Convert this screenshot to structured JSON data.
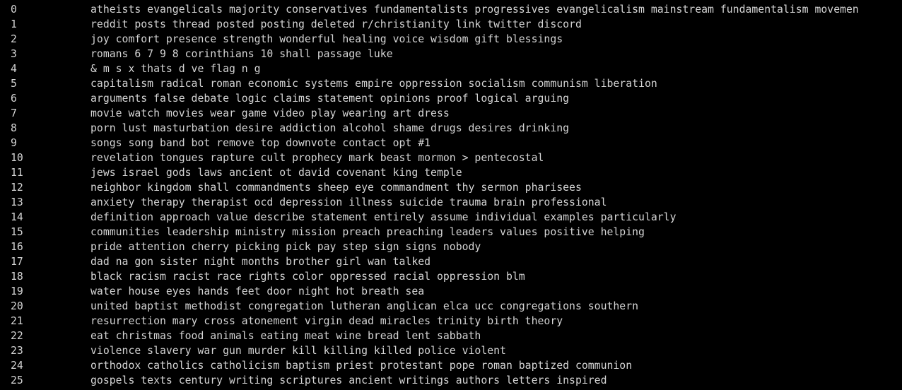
{
  "output": {
    "rows": [
      {
        "index": "0",
        "words": "atheists evangelicals majority conservatives fundamentalists progressives evangelicalism mainstream fundamentalism movemen"
      },
      {
        "index": "1",
        "words": "reddit posts thread posted posting deleted r/christianity link twitter discord"
      },
      {
        "index": "2",
        "words": "joy comfort presence strength wonderful healing voice wisdom gift blessings"
      },
      {
        "index": "3",
        "words": "romans 6 7 9 8 corinthians 10 shall passage luke"
      },
      {
        "index": "4",
        "words": "& m s x thats d ve flag n g"
      },
      {
        "index": "5",
        "words": "capitalism radical roman economic systems empire oppression socialism communism liberation"
      },
      {
        "index": "6",
        "words": "arguments false debate logic claims statement opinions proof logical arguing"
      },
      {
        "index": "7",
        "words": "movie watch movies wear game video play wearing art dress"
      },
      {
        "index": "8",
        "words": "porn lust masturbation desire addiction alcohol shame drugs desires drinking"
      },
      {
        "index": "9",
        "words": "songs song band bot remove top downvote contact opt #1"
      },
      {
        "index": "10",
        "words": "revelation tongues rapture cult prophecy mark beast mormon > pentecostal"
      },
      {
        "index": "11",
        "words": "jews israel gods laws ancient ot david covenant king temple"
      },
      {
        "index": "12",
        "words": "neighbor kingdom shall commandments sheep eye commandment thy sermon pharisees"
      },
      {
        "index": "13",
        "words": "anxiety therapy therapist ocd depression illness suicide trauma brain professional"
      },
      {
        "index": "14",
        "words": "definition approach value describe statement entirely assume individual examples particularly"
      },
      {
        "index": "15",
        "words": "communities leadership ministry mission preach preaching leaders values positive helping"
      },
      {
        "index": "16",
        "words": "pride attention cherry picking pick pay step sign signs nobody"
      },
      {
        "index": "17",
        "words": "dad na gon sister night months brother girl wan talked"
      },
      {
        "index": "18",
        "words": "black racism racist race rights color oppressed racial oppression blm"
      },
      {
        "index": "19",
        "words": "water house eyes hands feet door night hot breath sea"
      },
      {
        "index": "20",
        "words": "united baptist methodist congregation lutheran anglican elca ucc congregations southern"
      },
      {
        "index": "21",
        "words": "resurrection mary cross atonement virgin dead miracles trinity birth theory"
      },
      {
        "index": "22",
        "words": "eat christmas food animals eating meat wine bread lent sabbath"
      },
      {
        "index": "23",
        "words": "violence slavery war gun murder kill killing killed police violent"
      },
      {
        "index": "24",
        "words": "orthodox catholics catholicism baptism priest protestant pope roman baptized communion"
      },
      {
        "index": "25",
        "words": "gospels texts century writing scriptures ancient writings authors letters inspired"
      }
    ]
  }
}
